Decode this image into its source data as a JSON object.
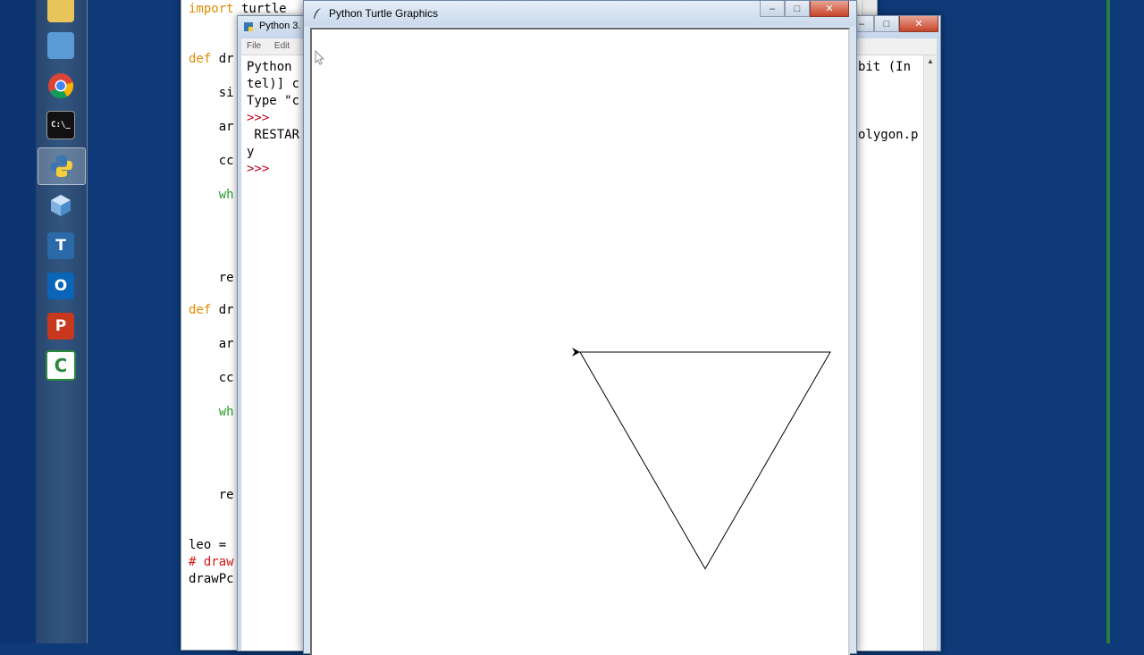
{
  "launcher": {
    "apps": [
      {
        "name": "file-explorer",
        "label": ""
      },
      {
        "name": "control-panel",
        "label": ""
      },
      {
        "name": "chrome",
        "label": ""
      },
      {
        "name": "command-prompt",
        "label": "C:\\_"
      },
      {
        "name": "python",
        "label": ""
      },
      {
        "name": "virtualbox",
        "label": ""
      },
      {
        "name": "teamviewer",
        "label": "T"
      },
      {
        "name": "outlook",
        "label": "O"
      },
      {
        "name": "powerpoint",
        "label": "P"
      },
      {
        "name": "camtasia",
        "label": "C"
      }
    ],
    "active_index": 4
  },
  "editor": {
    "lines": [
      {
        "kw": "import",
        "rest": " turtle"
      },
      {
        "kw": "def",
        "rest": " dr"
      },
      {
        "kw": "",
        "rest": "    si"
      },
      {
        "kw": "",
        "rest": "    ar"
      },
      {
        "kw": "",
        "rest": "    cc"
      },
      {
        "kw": "",
        "rest": "    wh"
      },
      {
        "kw": "",
        "rest": "    re"
      },
      {
        "kw": "def",
        "rest": " dr"
      },
      {
        "kw": "",
        "rest": "    ar"
      },
      {
        "kw": "",
        "rest": "    cc"
      },
      {
        "kw": "",
        "rest": "    wh"
      },
      {
        "kw": "",
        "rest": "    re"
      },
      {
        "kw": "",
        "rest": "leo ="
      },
      {
        "kw": "",
        "rest": "# draw"
      },
      {
        "kw": "",
        "rest": "drawPc"
      }
    ]
  },
  "shell": {
    "title": "Python 3.",
    "menu": [
      "File",
      "Edit"
    ],
    "lines_left": [
      "Python",
      "tel)] c",
      "Type \"c",
      ">>>",
      " RESTAR",
      "y",
      ">>>"
    ],
    "lines_right": [
      "bit (In",
      "",
      "",
      "",
      "olygon.p"
    ]
  },
  "turtle": {
    "title": "Python Turtle Graphics",
    "shape": {
      "type": "triangle",
      "side": 280,
      "heading_deg": 180
    }
  },
  "colors": {
    "keyword": "#e08b00",
    "comment": "#d21a1a",
    "prompt": "#c00020",
    "desktop": "#0e3a78"
  }
}
